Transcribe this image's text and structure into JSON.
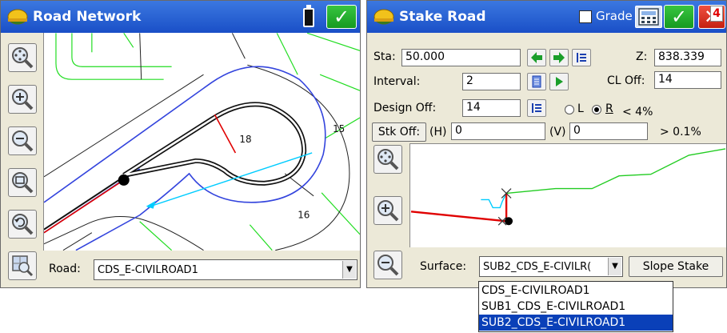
{
  "left_window": {
    "title": "Road Network",
    "icons": [
      "helmet-icon",
      "battery-icon",
      "check-icon",
      "zoom-extents-icon",
      "zoom-in-icon",
      "zoom-out-icon",
      "zoom-window-icon",
      "zoom-previous-icon",
      "map-view-icon"
    ],
    "ok_symbol": "✓",
    "map_labels": {
      "station_18": "18",
      "station_15": "15",
      "station_16": "16"
    },
    "road_label": "Road:",
    "road_value": "CDS_E-CIVILROAD1",
    "combo_arrow": "▼"
  },
  "right_window": {
    "title": "Stake Road",
    "grade_label": "Grade",
    "ok_symbol": "✓",
    "close_symbol": "✕",
    "sta_label": "Sta:",
    "sta_value": "50.000",
    "z_label": "Z:",
    "z_value": "838.339",
    "interval_label": "Interval:",
    "interval_value": "2",
    "cl_off_label": "CL Off:",
    "cl_off_value": "14",
    "design_off_label": "Design Off:",
    "design_off_value": "14",
    "radio_left": "L",
    "radio_right": "R",
    "selected_side": "R",
    "slope_upper": "< 4%",
    "slope_lower": "> 0.1%",
    "stk_off_label": "Stk Off:",
    "h_label": "(H)",
    "h_value": "0",
    "v_label": "(V)",
    "v_value": "0",
    "page_number": "4",
    "surface_label": "Surface:",
    "surface_value": "SUB2_CDS_E-CIVILR(",
    "combo_arrow": "▼",
    "slope_stake_button": "Slope Stake",
    "surface_options": [
      "CDS_E-CIVILROAD1",
      "SUB1_CDS_E-CIVILROAD1",
      "SUB2_CDS_E-CIVILROAD1"
    ],
    "selected_surface_index": 2
  },
  "colors": {
    "title_bar": "#1a4fc7",
    "ok_button": "#169a20",
    "close_button": "#c42010",
    "road_outline": "#3344dd",
    "parcel_lines": "#22dd22",
    "alignment": "#e00000",
    "stake_line": "#00ccff",
    "selection": "#0a40b8"
  }
}
